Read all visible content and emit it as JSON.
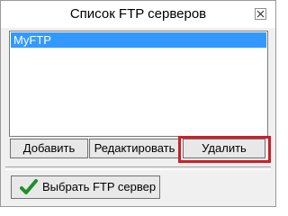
{
  "window": {
    "title": "Список FTP серверов"
  },
  "servers": {
    "items": [
      "MyFTP"
    ],
    "selected_index": 0
  },
  "buttons": {
    "add": "Добавить",
    "edit": "Редактировать",
    "delete": "Удалить",
    "select": "Выбрать FTP сервер"
  },
  "icons": {
    "close": "close-icon",
    "select": "checkmark-icon"
  },
  "colors": {
    "selection": "#3399ff",
    "highlight": "#cc1f2a",
    "checkmark": "#1f8f2a"
  }
}
